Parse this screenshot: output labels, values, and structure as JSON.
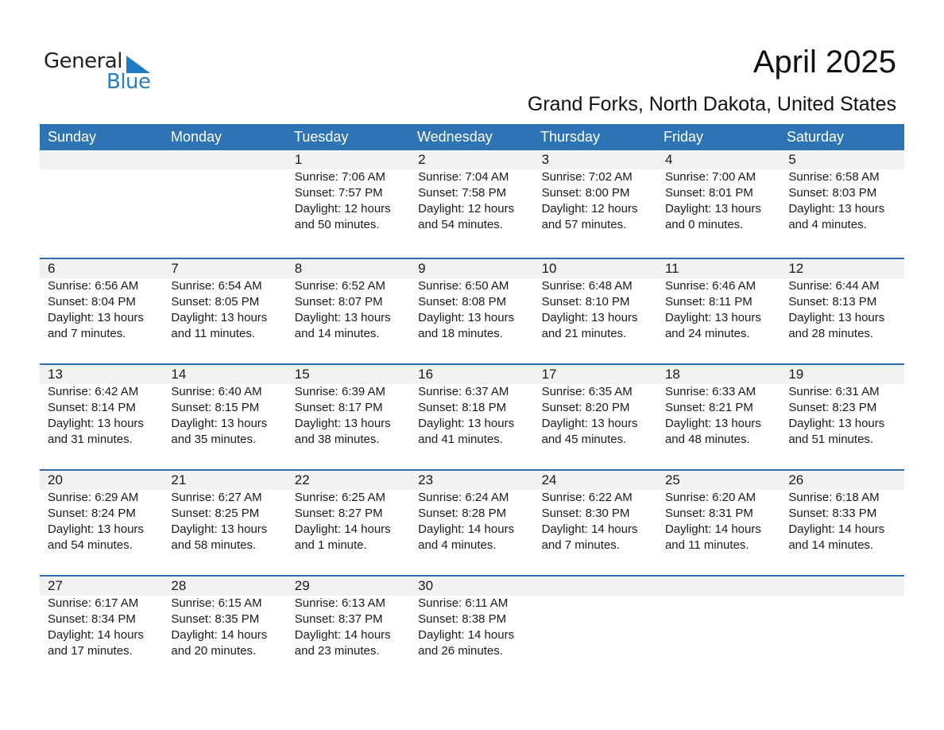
{
  "logo": {
    "line1": "General",
    "line2": "Blue"
  },
  "header": {
    "title": "April 2025",
    "location": "Grand Forks, North Dakota, United States"
  },
  "colors": {
    "header_bg": "#2e73b4",
    "accent": "#1f7bc0",
    "date_band": "#f2f2f2"
  },
  "weekdays": [
    "Sunday",
    "Monday",
    "Tuesday",
    "Wednesday",
    "Thursday",
    "Friday",
    "Saturday"
  ],
  "weeks": [
    [
      null,
      null,
      {
        "day": "1",
        "sunrise": "Sunrise: 7:06 AM",
        "sunset": "Sunset: 7:57 PM",
        "daylight": "Daylight: 12 hours",
        "minutes": "and 50 minutes."
      },
      {
        "day": "2",
        "sunrise": "Sunrise: 7:04 AM",
        "sunset": "Sunset: 7:58 PM",
        "daylight": "Daylight: 12 hours",
        "minutes": "and 54 minutes."
      },
      {
        "day": "3",
        "sunrise": "Sunrise: 7:02 AM",
        "sunset": "Sunset: 8:00 PM",
        "daylight": "Daylight: 12 hours",
        "minutes": "and 57 minutes."
      },
      {
        "day": "4",
        "sunrise": "Sunrise: 7:00 AM",
        "sunset": "Sunset: 8:01 PM",
        "daylight": "Daylight: 13 hours",
        "minutes": "and 0 minutes."
      },
      {
        "day": "5",
        "sunrise": "Sunrise: 6:58 AM",
        "sunset": "Sunset: 8:03 PM",
        "daylight": "Daylight: 13 hours",
        "minutes": "and 4 minutes."
      }
    ],
    [
      {
        "day": "6",
        "sunrise": "Sunrise: 6:56 AM",
        "sunset": "Sunset: 8:04 PM",
        "daylight": "Daylight: 13 hours",
        "minutes": "and 7 minutes."
      },
      {
        "day": "7",
        "sunrise": "Sunrise: 6:54 AM",
        "sunset": "Sunset: 8:05 PM",
        "daylight": "Daylight: 13 hours",
        "minutes": "and 11 minutes."
      },
      {
        "day": "8",
        "sunrise": "Sunrise: 6:52 AM",
        "sunset": "Sunset: 8:07 PM",
        "daylight": "Daylight: 13 hours",
        "minutes": "and 14 minutes."
      },
      {
        "day": "9",
        "sunrise": "Sunrise: 6:50 AM",
        "sunset": "Sunset: 8:08 PM",
        "daylight": "Daylight: 13 hours",
        "minutes": "and 18 minutes."
      },
      {
        "day": "10",
        "sunrise": "Sunrise: 6:48 AM",
        "sunset": "Sunset: 8:10 PM",
        "daylight": "Daylight: 13 hours",
        "minutes": "and 21 minutes."
      },
      {
        "day": "11",
        "sunrise": "Sunrise: 6:46 AM",
        "sunset": "Sunset: 8:11 PM",
        "daylight": "Daylight: 13 hours",
        "minutes": "and 24 minutes."
      },
      {
        "day": "12",
        "sunrise": "Sunrise: 6:44 AM",
        "sunset": "Sunset: 8:13 PM",
        "daylight": "Daylight: 13 hours",
        "minutes": "and 28 minutes."
      }
    ],
    [
      {
        "day": "13",
        "sunrise": "Sunrise: 6:42 AM",
        "sunset": "Sunset: 8:14 PM",
        "daylight": "Daylight: 13 hours",
        "minutes": "and 31 minutes."
      },
      {
        "day": "14",
        "sunrise": "Sunrise: 6:40 AM",
        "sunset": "Sunset: 8:15 PM",
        "daylight": "Daylight: 13 hours",
        "minutes": "and 35 minutes."
      },
      {
        "day": "15",
        "sunrise": "Sunrise: 6:39 AM",
        "sunset": "Sunset: 8:17 PM",
        "daylight": "Daylight: 13 hours",
        "minutes": "and 38 minutes."
      },
      {
        "day": "16",
        "sunrise": "Sunrise: 6:37 AM",
        "sunset": "Sunset: 8:18 PM",
        "daylight": "Daylight: 13 hours",
        "minutes": "and 41 minutes."
      },
      {
        "day": "17",
        "sunrise": "Sunrise: 6:35 AM",
        "sunset": "Sunset: 8:20 PM",
        "daylight": "Daylight: 13 hours",
        "minutes": "and 45 minutes."
      },
      {
        "day": "18",
        "sunrise": "Sunrise: 6:33 AM",
        "sunset": "Sunset: 8:21 PM",
        "daylight": "Daylight: 13 hours",
        "minutes": "and 48 minutes."
      },
      {
        "day": "19",
        "sunrise": "Sunrise: 6:31 AM",
        "sunset": "Sunset: 8:23 PM",
        "daylight": "Daylight: 13 hours",
        "minutes": "and 51 minutes."
      }
    ],
    [
      {
        "day": "20",
        "sunrise": "Sunrise: 6:29 AM",
        "sunset": "Sunset: 8:24 PM",
        "daylight": "Daylight: 13 hours",
        "minutes": "and 54 minutes."
      },
      {
        "day": "21",
        "sunrise": "Sunrise: 6:27 AM",
        "sunset": "Sunset: 8:25 PM",
        "daylight": "Daylight: 13 hours",
        "minutes": "and 58 minutes."
      },
      {
        "day": "22",
        "sunrise": "Sunrise: 6:25 AM",
        "sunset": "Sunset: 8:27 PM",
        "daylight": "Daylight: 14 hours",
        "minutes": "and 1 minute."
      },
      {
        "day": "23",
        "sunrise": "Sunrise: 6:24 AM",
        "sunset": "Sunset: 8:28 PM",
        "daylight": "Daylight: 14 hours",
        "minutes": "and 4 minutes."
      },
      {
        "day": "24",
        "sunrise": "Sunrise: 6:22 AM",
        "sunset": "Sunset: 8:30 PM",
        "daylight": "Daylight: 14 hours",
        "minutes": "and 7 minutes."
      },
      {
        "day": "25",
        "sunrise": "Sunrise: 6:20 AM",
        "sunset": "Sunset: 8:31 PM",
        "daylight": "Daylight: 14 hours",
        "minutes": "and 11 minutes."
      },
      {
        "day": "26",
        "sunrise": "Sunrise: 6:18 AM",
        "sunset": "Sunset: 8:33 PM",
        "daylight": "Daylight: 14 hours",
        "minutes": "and 14 minutes."
      }
    ],
    [
      {
        "day": "27",
        "sunrise": "Sunrise: 6:17 AM",
        "sunset": "Sunset: 8:34 PM",
        "daylight": "Daylight: 14 hours",
        "minutes": "and 17 minutes."
      },
      {
        "day": "28",
        "sunrise": "Sunrise: 6:15 AM",
        "sunset": "Sunset: 8:35 PM",
        "daylight": "Daylight: 14 hours",
        "minutes": "and 20 minutes."
      },
      {
        "day": "29",
        "sunrise": "Sunrise: 6:13 AM",
        "sunset": "Sunset: 8:37 PM",
        "daylight": "Daylight: 14 hours",
        "minutes": "and 23 minutes."
      },
      {
        "day": "30",
        "sunrise": "Sunrise: 6:11 AM",
        "sunset": "Sunset: 8:38 PM",
        "daylight": "Daylight: 14 hours",
        "minutes": "and 26 minutes."
      },
      null,
      null,
      null
    ]
  ]
}
